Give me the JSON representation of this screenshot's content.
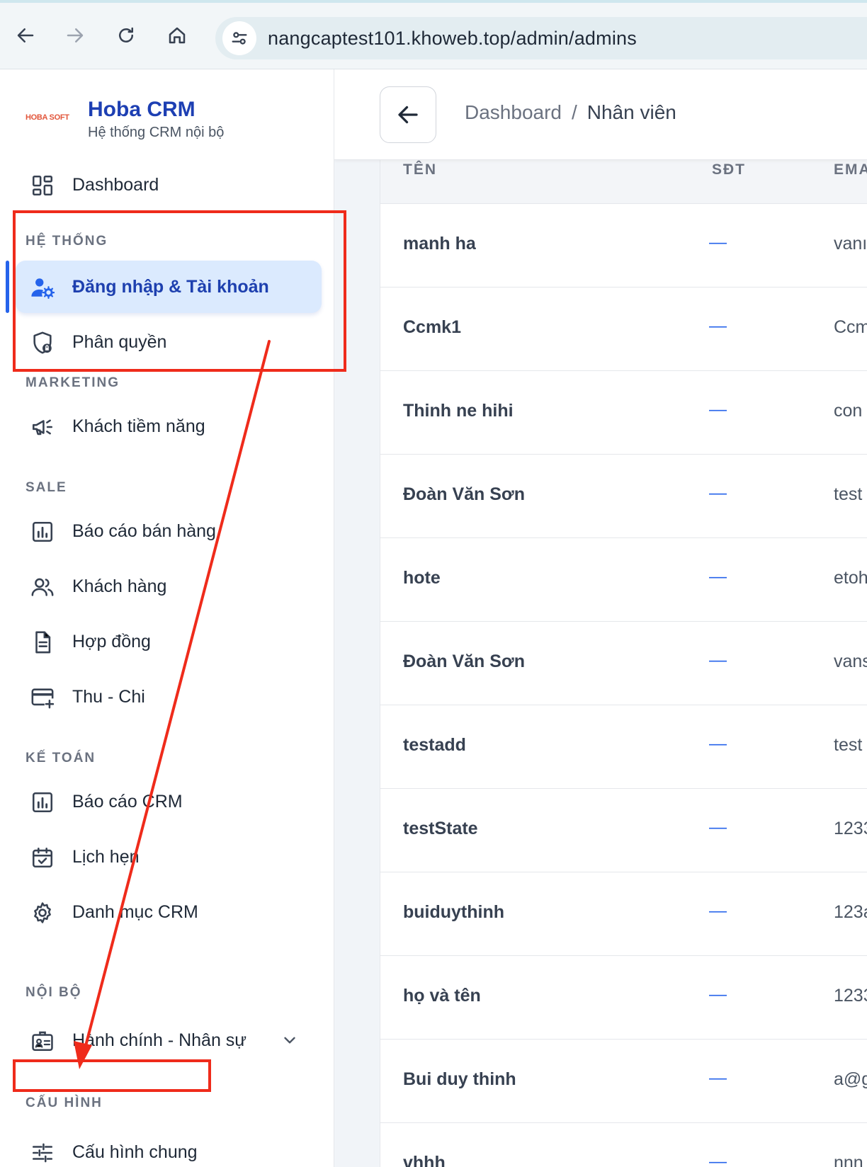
{
  "browser": {
    "url": "nangcaptest101.khoweb.top/admin/admins"
  },
  "brand": {
    "logo_text": "HOBA SOFT",
    "name": "Hoba CRM",
    "subtitle": "Hệ thống CRM nội bộ"
  },
  "sidebar": {
    "dashboard": "Dashboard",
    "sections": {
      "he_thong": "HỆ THỐNG",
      "marketing": "MARKETING",
      "sale": "SALE",
      "ke_toan": "KẾ TOÁN",
      "noi_bo": "NỘI BỘ",
      "cau_hinh": "CẤU HÌNH"
    },
    "items": {
      "login_accounts": "Đăng nhập & Tài khoản",
      "permissions": "Phân quyền",
      "leads": "Khách tiềm năng",
      "sales_report": "Báo cáo bán hàng",
      "customers": "Khách hàng",
      "contracts": "Hợp đồng",
      "income_expense": "Thu - Chi",
      "crm_report": "Báo cáo CRM",
      "appointments": "Lịch hẹn",
      "crm_catalog": "Danh mục CRM",
      "hr_admin": "Hành chính - Nhân sự",
      "general_config": "Cấu hình chung"
    }
  },
  "breadcrumb": {
    "home": "Dashboard",
    "separator": "/",
    "current": "Nhân viên"
  },
  "table": {
    "headers": {
      "name": "TÊN",
      "phone": "SĐT",
      "email": "EMA"
    },
    "rows": [
      {
        "name": "manh ha",
        "phone": "—",
        "email": "vanı"
      },
      {
        "name": "Ccmk1",
        "phone": "—",
        "email": "Ccm"
      },
      {
        "name": "Thinh ne hihi",
        "phone": "—",
        "email": "con"
      },
      {
        "name": "Đoàn Văn Sơn",
        "phone": "—",
        "email": "test"
      },
      {
        "name": "hote",
        "phone": "—",
        "email": "etoh"
      },
      {
        "name": "Đoàn Văn Sơn",
        "phone": "—",
        "email": "vans"
      },
      {
        "name": "testadd",
        "phone": "—",
        "email": "test"
      },
      {
        "name": "testState",
        "phone": "—",
        "email": "1233"
      },
      {
        "name": "buiduythinh",
        "phone": "—",
        "email": "123a"
      },
      {
        "name": "họ và tên",
        "phone": "—",
        "email": "1233"
      },
      {
        "name": "Bui duy thinh",
        "phone": "—",
        "email": "a@g"
      },
      {
        "name": "vhhh",
        "phone": "—",
        "email": "nnn"
      }
    ]
  },
  "colors": {
    "brand_blue": "#1d3fb3",
    "active_bg": "#dbeafe",
    "annotation_red": "#ef2b1b"
  }
}
